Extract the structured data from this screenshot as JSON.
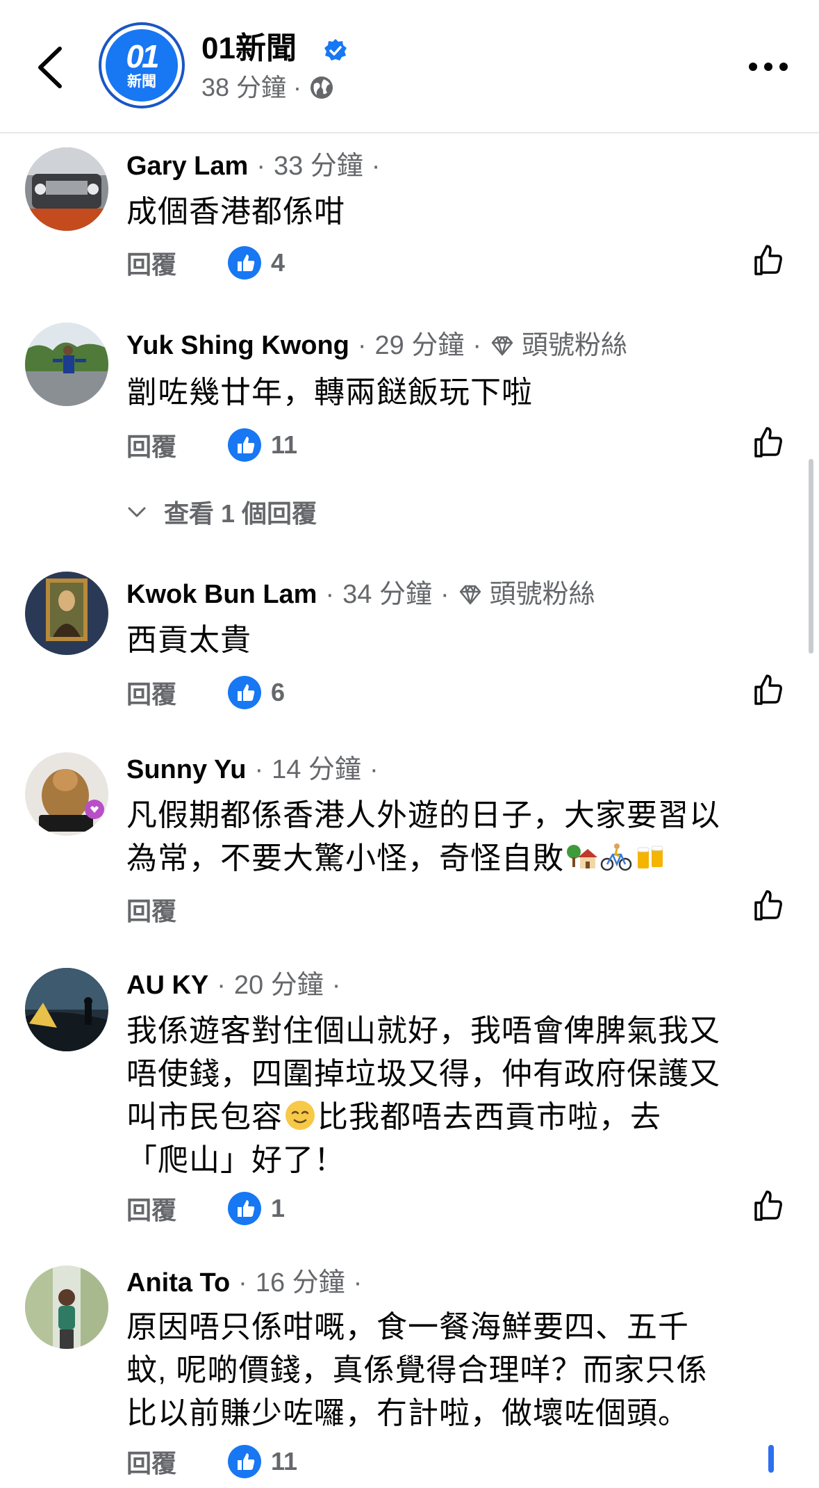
{
  "header": {
    "page_name": "01新聞",
    "post_time": "38 分鐘",
    "logo_mark": "01",
    "logo_sub": "新聞"
  },
  "labels": {
    "reply": "回覆"
  },
  "comments": [
    {
      "author": "Gary Lam",
      "time": "33 分鐘",
      "badge": "",
      "text": "成個香港都係咁",
      "likes": "4"
    },
    {
      "author": "Yuk Shing Kwong",
      "time": "29 分鐘",
      "badge": "頭號粉絲",
      "text": "劏咗幾廿年，轉兩餸飯玩下啦",
      "likes": "11",
      "view_replies": "查看 1 個回覆"
    },
    {
      "author": "Kwok Bun Lam",
      "time": "34 分鐘",
      "badge": "頭號粉絲",
      "text": "西貢太貴",
      "likes": "6"
    },
    {
      "author": "Sunny Yu",
      "time": "14 分鐘",
      "badge": "",
      "text_line1": "凡假期都係香港人外遊的日子，大家要習以",
      "text_line2": "為常，不要大驚小怪，奇怪自敗",
      "likes": ""
    },
    {
      "author": "AU KY",
      "time": "20 分鐘",
      "badge": "",
      "text_line1": "我係遊客對住個山就好，我唔會俾脾氣我又",
      "text_line2": "唔使錢，四圍掉垃圾又得，仲有政府保護又",
      "text_line3a": "叫市民包容",
      "text_line3b": "比我都唔去西貢市啦，去",
      "text_line4": "「爬山」好了！",
      "likes": "1"
    },
    {
      "author": "Anita To",
      "time": "16 分鐘",
      "badge": "",
      "text_line1": "原因唔只係咁嘅，食一餐海鮮要四、五千",
      "text_line2": "蚊, 呢啲價錢，真係覺得合理咩？而家只係",
      "text_line3": "比以前賺少咗囉，冇計啦，做壞咗個頭。",
      "likes": "11"
    }
  ],
  "colors": {
    "accent": "#1877f2",
    "secondary_text": "#65676b",
    "primary_text": "#050505"
  },
  "icons": [
    "back-arrow-icon",
    "verified-badge-icon",
    "globe-icon",
    "more-dots-icon",
    "diamond-icon",
    "like-badge-icon",
    "thumbs-up-outline-icon",
    "chevron-down-icon",
    "house-tree-emoji",
    "bicycle-emoji",
    "beer-emoji",
    "relieved-face-emoji"
  ]
}
